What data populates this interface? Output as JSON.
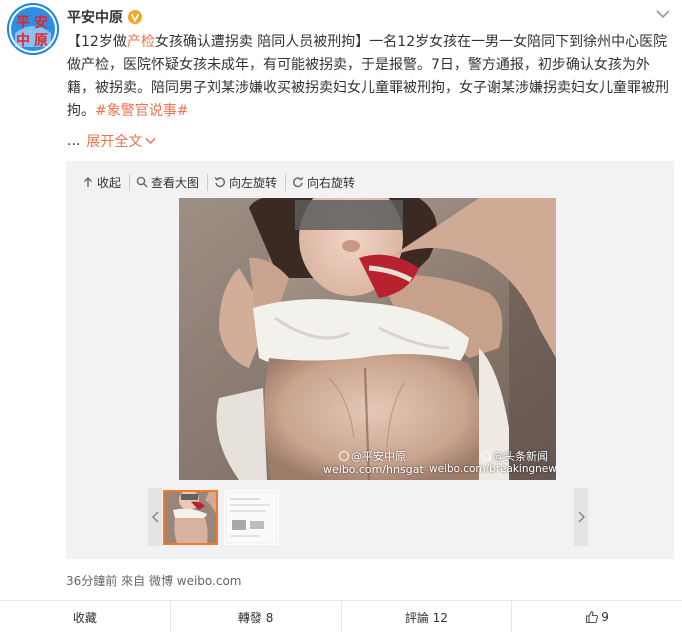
{
  "user": {
    "name": "平安中原",
    "avatar_chars": "平安中原"
  },
  "post": {
    "headline_start": "【12岁做",
    "headline_highlight": "产检",
    "headline_end": "女孩确认遭拐卖 陪同人员被刑拘】",
    "body": "一名12岁女孩在一男一女陪同下到徐州中心医院做产检，医院怀疑女孩未成年，有可能被拐卖，于是报警。7日，警方通报，初步确认女孩为外籍，被拐卖。陪同男子刘某涉嫌收买被拐卖妇女儿童罪被刑拘，女子谢某涉嫌拐卖妇女儿童罪被刑拘。",
    "hashtag": "#象警官说事#",
    "ellipsis": "...",
    "expand_label": "展开全文"
  },
  "media_toolbar": {
    "collapse": "收起",
    "view_large": "查看大图",
    "rotate_left": "向左旋转",
    "rotate_right": "向右旋转"
  },
  "watermarks": {
    "left_handle": "@平安中原",
    "left_url": "weibo.com/hnsgat",
    "right_handle": "@头条新闻",
    "right_url": "weibo.com/breakingnews"
  },
  "meta": {
    "time": "36分鐘前",
    "from_label": "來自",
    "source": "微博 weibo.com"
  },
  "actions": {
    "favorite": "收藏",
    "repost": "轉發 8",
    "comment": "評論 12",
    "like_count": "9"
  },
  "colors": {
    "accent": "#eb7350",
    "thumb_border": "#f37925",
    "media_bg": "#f2f2f5",
    "verified": "#f5a623"
  }
}
